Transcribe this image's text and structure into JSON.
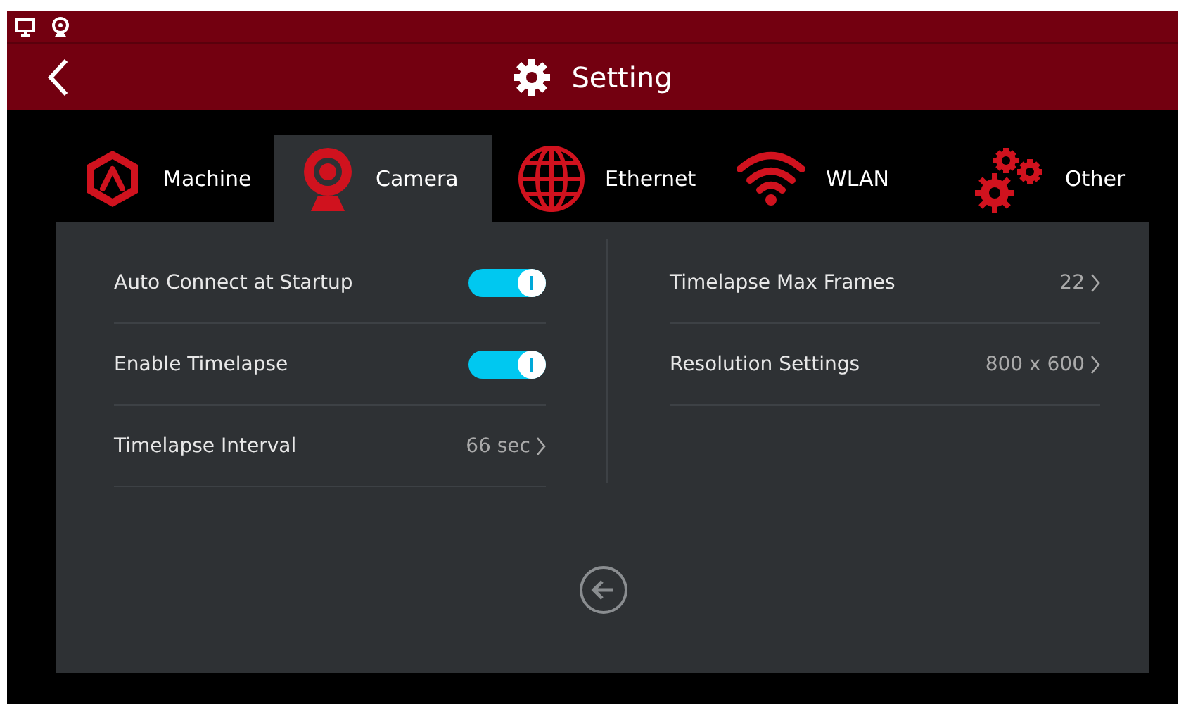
{
  "header": {
    "title": "Setting"
  },
  "tabs": [
    {
      "label": "Machine",
      "kind": "machine",
      "selected": false
    },
    {
      "label": "Camera",
      "kind": "camera",
      "selected": true
    },
    {
      "label": "Ethernet",
      "kind": "globe",
      "selected": false
    },
    {
      "label": "WLAN",
      "kind": "wifi",
      "selected": false
    },
    {
      "label": "Other",
      "kind": "gears",
      "selected": false
    }
  ],
  "left_settings": [
    {
      "kind": "toggle",
      "label": "Auto Connect at Startup",
      "on": true
    },
    {
      "kind": "toggle",
      "label": "Enable Timelapse",
      "on": true
    },
    {
      "kind": "value",
      "label": "Timelapse Interval",
      "value": "66 sec"
    }
  ],
  "right_settings": [
    {
      "kind": "value",
      "label": "Timelapse Max Frames",
      "value": "22"
    },
    {
      "kind": "value",
      "label": "Resolution Settings",
      "value": "800 x 600"
    }
  ]
}
